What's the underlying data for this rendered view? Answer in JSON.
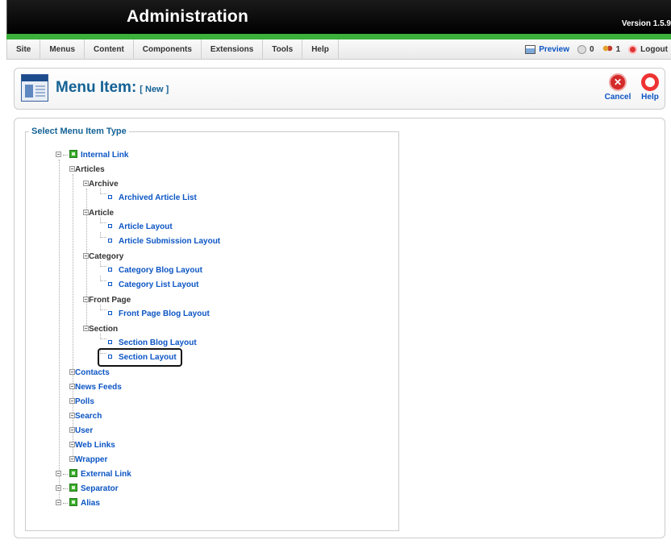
{
  "header": {
    "title": "Administration",
    "version": "Version 1.5.9"
  },
  "menubar": {
    "items": [
      "Site",
      "Menus",
      "Content",
      "Components",
      "Extensions",
      "Tools",
      "Help"
    ],
    "status": {
      "preview": "Preview",
      "messages": "0",
      "users": "1",
      "logout": "Logout"
    }
  },
  "toolbar": {
    "title": "Menu Item:",
    "subtitle": "[ New ]",
    "cancel_label": "Cancel",
    "help_label": "Help"
  },
  "panel": {
    "legend": "Select Menu Item Type",
    "tree": {
      "internal_link": "Internal Link",
      "articles": "Articles",
      "archive": "Archive",
      "archived_article_list": "Archived Article List",
      "article": "Article",
      "article_layout": "Article Layout",
      "article_submission_layout": "Article Submission Layout",
      "category": "Category",
      "category_blog_layout": "Category Blog Layout",
      "category_list_layout": "Category List Layout",
      "front_page": "Front Page",
      "front_page_blog_layout": "Front Page Blog Layout",
      "section": "Section",
      "section_blog_layout": "Section Blog Layout",
      "section_layout": "Section Layout",
      "contacts": "Contacts",
      "news_feeds": "News Feeds",
      "polls": "Polls",
      "search": "Search",
      "user": "User",
      "web_links": "Web Links",
      "wrapper": "Wrapper",
      "external_link": "External Link",
      "separator": "Separator",
      "alias": "Alias"
    }
  },
  "colors": {
    "link": "#0b55c4",
    "title": "#146295",
    "header_bar": "#3bb03b"
  },
  "icons": [
    "preview-icon",
    "messages-icon",
    "users-icon",
    "logout-icon",
    "menu-item-page-icon",
    "cancel-icon",
    "help-icon"
  ]
}
